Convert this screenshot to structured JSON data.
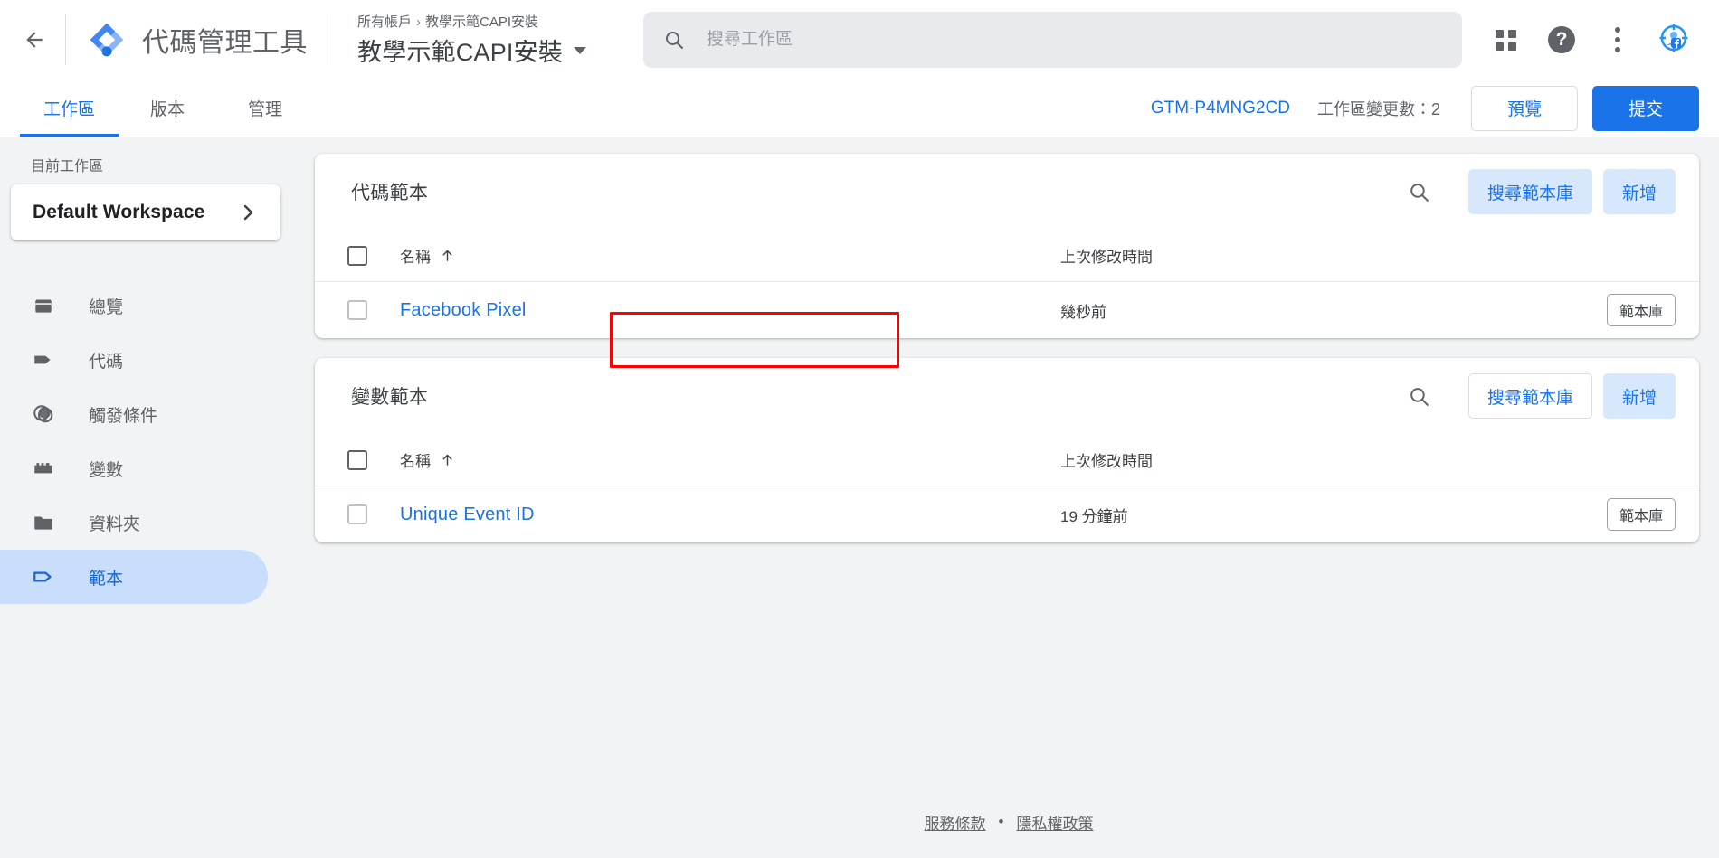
{
  "header": {
    "back_icon": "arrow-back-icon",
    "logo_icon": "gtm-logo-icon",
    "product_name": "代碼管理工具",
    "breadcrumb_root": "所有帳戶",
    "breadcrumb_sep": "›",
    "breadcrumb_current": "教學示範CAPI安裝",
    "account_title": "教學示範CAPI安裝",
    "search_placeholder": "搜尋工作區",
    "search_value": "",
    "apps_icon": "apps-grid-icon",
    "help_icon": "help-icon",
    "help_glyph": "?",
    "more_icon": "more-vert-icon",
    "extension_icon": "facebook-pixel-helper-icon"
  },
  "tabs": [
    {
      "label": "工作區",
      "active": true
    },
    {
      "label": "版本",
      "active": false
    },
    {
      "label": "管理",
      "active": false
    }
  ],
  "tabbar_right": {
    "container_id": "GTM-P4MNG2CD",
    "changes_label": "工作區變更數：2",
    "preview_label": "預覽",
    "submit_label": "提交"
  },
  "sidebar": {
    "workspace_label": "目前工作區",
    "workspace_name": "Default Workspace",
    "workspace_chevron_icon": "chevron-right-icon",
    "items": [
      {
        "label": "總覽",
        "icon": "overview-icon",
        "active": false
      },
      {
        "label": "代碼",
        "icon": "tag-icon",
        "active": false
      },
      {
        "label": "觸發條件",
        "icon": "trigger-icon",
        "active": false
      },
      {
        "label": "變數",
        "icon": "variable-icon",
        "active": false
      },
      {
        "label": "資料夾",
        "icon": "folder-icon",
        "active": false
      },
      {
        "label": "範本",
        "icon": "template-icon",
        "active": true
      }
    ]
  },
  "cards": [
    {
      "title": "代碼範本",
      "search_icon": "search-icon",
      "gallery_button": "搜尋範本庫",
      "gallery_button_style": "tonal",
      "new_button": "新增",
      "new_button_style": "tonal",
      "columns": {
        "name": "名稱",
        "sort_icon": "sort-asc-icon",
        "modified": "上次修改時間"
      },
      "rows": [
        {
          "name": "Facebook Pixel",
          "modified": "幾秒前",
          "chip": "範本庫",
          "highlighted": true
        }
      ]
    },
    {
      "title": "變數範本",
      "search_icon": "search-icon",
      "gallery_button": "搜尋範本庫",
      "gallery_button_style": "plain",
      "new_button": "新增",
      "new_button_style": "tonal",
      "columns": {
        "name": "名稱",
        "sort_icon": "sort-asc-icon",
        "modified": "上次修改時間"
      },
      "rows": [
        {
          "name": "Unique Event ID",
          "modified": "19 分鐘前",
          "chip": "範本庫",
          "highlighted": false
        }
      ]
    }
  ],
  "footer": {
    "terms": "服務條款",
    "separator": "•",
    "privacy": "隱私權政策"
  },
  "colors": {
    "accent": "#1a73e8",
    "tonal_button_bg": "#d7e8fc",
    "nav_active_bg": "#c9ddfc",
    "page_bg": "#f1f3f4",
    "annotation": "#ff0000",
    "text_primary": "#3c4043",
    "text_secondary": "#5f6368"
  }
}
